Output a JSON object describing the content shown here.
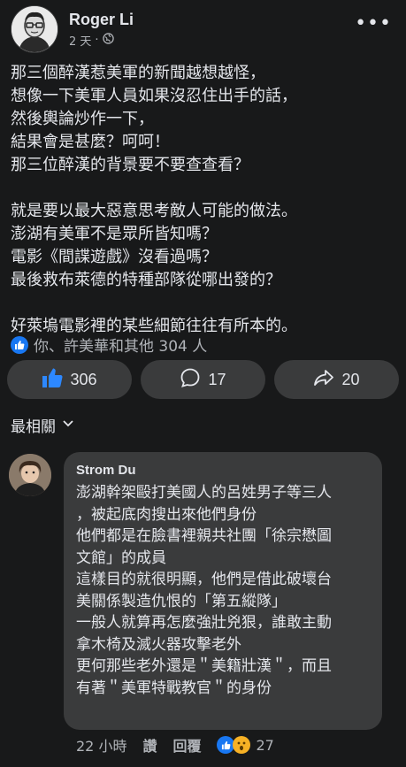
{
  "post": {
    "author": "Roger Li",
    "time": "2 天",
    "visibility_icon": "globe-icon",
    "lines_p1": [
      "那三個醉漢惹美軍的新聞越想越怪，",
      "想像一下美軍人員如果沒忍住出手的話，",
      "然後輿論炒作一下，",
      "結果會是甚麼？呵呵！",
      "那三位醉漢的背景要不要查查看？"
    ],
    "lines_p2": [
      "就是要以最大惡意思考敵人可能的做法。",
      "澎湖有美軍不是眾所皆知嗎？",
      "電影《間諜遊戲》沒看過嗎？",
      "最後救布萊德的特種部隊從哪出發的？"
    ],
    "lines_p3": [
      "好萊塢電影裡的某些細節往往有所本的。"
    ],
    "reactions_summary": "你、許美華和其他 304 人"
  },
  "actions": {
    "like_count": "306",
    "comment_count": "17",
    "share_count": "20"
  },
  "sort": {
    "label": "最相關"
  },
  "comment": {
    "author": "Strom Du",
    "lines": [
      "澎湖幹架毆打美國人的呂姓男子等三人",
      "，被起底肉搜出來他們身份",
      "他們都是在臉書裡親共社團「徐宗懋圖",
      "文館」的成員",
      "這樣目的就很明顯，他們是借此破壞台",
      "美關係製造仇恨的「第五縱隊」",
      "一般人就算再怎麼強壯兇狠，誰敢主動",
      "拿木椅及滅火器攻擊老外",
      "更何那些老外還是＂美籍壯漢＂，而且",
      "有著＂美軍特戰教官＂的身份"
    ],
    "time": "22 小時",
    "like_label": "讚",
    "reply_label": "回覆",
    "reaction_count": "27"
  },
  "colors": {
    "background": "#18191a",
    "surface": "#3a3b3c",
    "text": "#e4e6eb",
    "secondary": "#b0b3b8",
    "accent": "#1877f2"
  }
}
